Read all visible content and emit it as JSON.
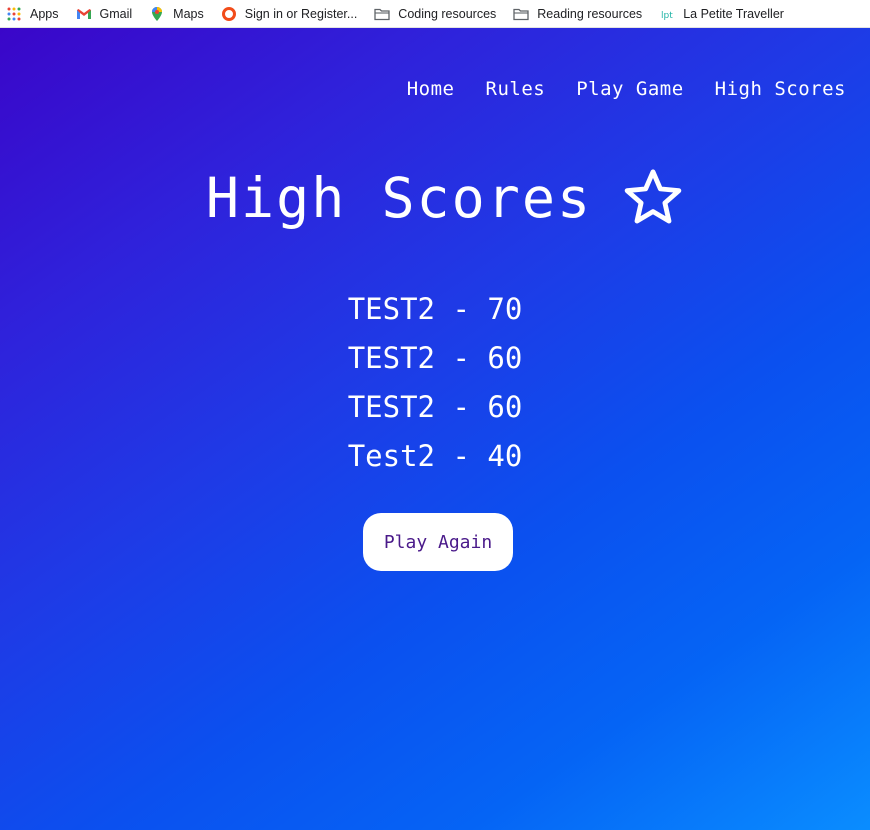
{
  "bookmarks": [
    {
      "label": "Apps",
      "icon": "apps-grid-icon"
    },
    {
      "label": "Gmail",
      "icon": "gmail-icon"
    },
    {
      "label": "Maps",
      "icon": "maps-pin-icon"
    },
    {
      "label": "Sign in or Register...",
      "icon": "ring-icon"
    },
    {
      "label": "Coding resources",
      "icon": "folder-icon"
    },
    {
      "label": "Reading resources",
      "icon": "folder-icon"
    },
    {
      "label": "La Petite Traveller",
      "icon": "lpt-icon"
    }
  ],
  "nav": {
    "home": "Home",
    "rules": "Rules",
    "play_game": "Play Game",
    "high_scores": "High Scores"
  },
  "page": {
    "title": "High Scores",
    "title_icon": "star-outline-icon"
  },
  "scores": [
    {
      "text": "TEST2 - 70"
    },
    {
      "text": "TEST2 - 60"
    },
    {
      "text": "TEST2 - 60"
    },
    {
      "text": "Test2 - 40"
    }
  ],
  "buttons": {
    "play_again": "Play Again"
  },
  "colors": {
    "gradient_start": "#3a06c9",
    "gradient_end": "#0a8dff",
    "button_text": "#4a1a8a"
  }
}
